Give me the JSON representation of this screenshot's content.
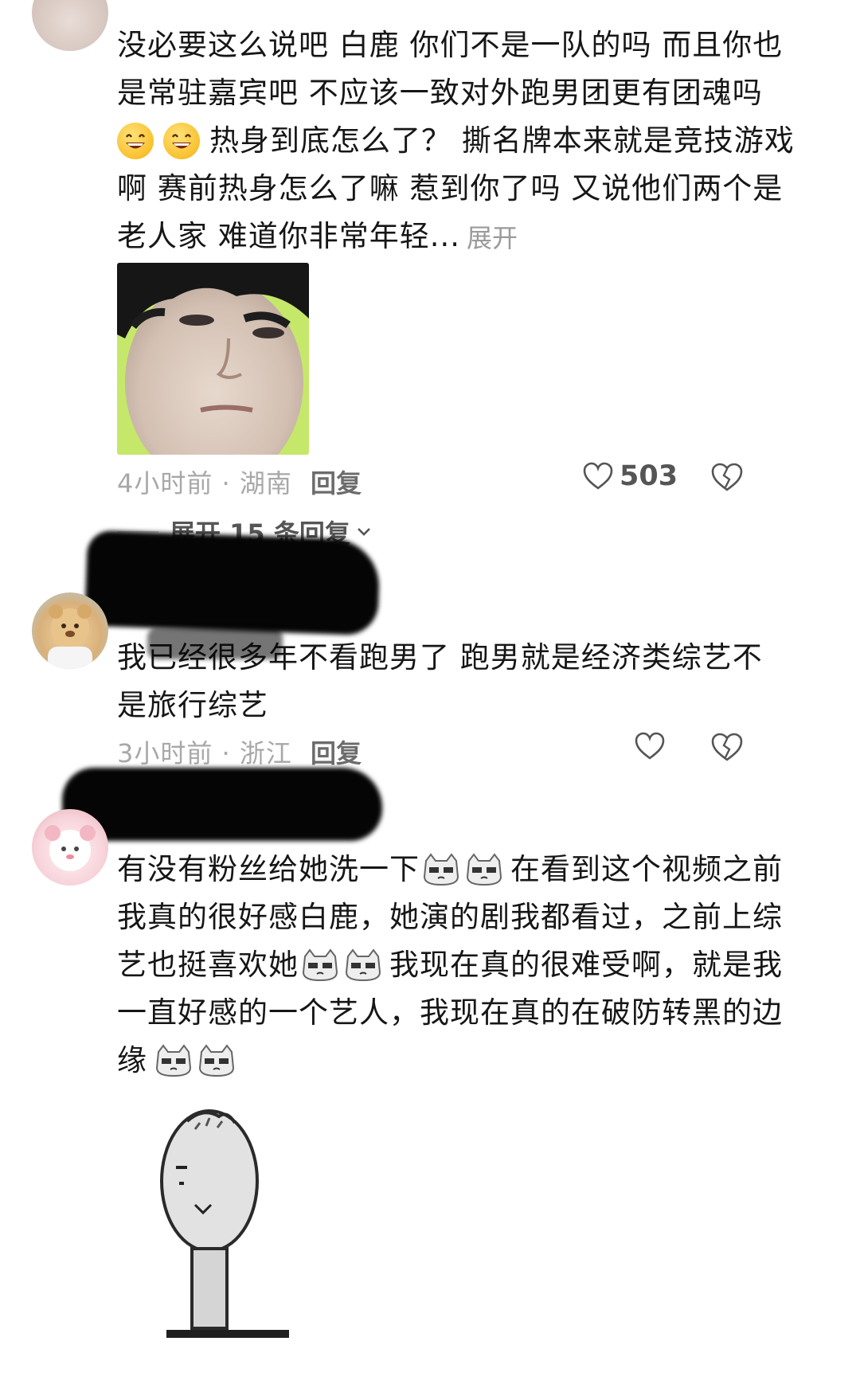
{
  "comments": [
    {
      "text_lines": [
        "没必要这么说吧 白鹿 你们不是一队的吗 而且你也",
        "是常驻嘉宾吧 不应该一致对外跑男团更有团魂吗",
        "热身到底怎么了？ 撕名牌本来就是竞技游戏",
        "啊 赛前热身怎么了嘛 惹到你了吗 又说他们两个是",
        "老人家 难道你非常年轻..."
      ],
      "emoji_inline": [
        "grinning-emoji",
        "grinning-emoji"
      ],
      "expand_label": "展开",
      "meta": "4小时前 · 湖南",
      "reply_label": "回复",
      "likes": "503",
      "sub_replies_label": "展开 15 条回复"
    },
    {
      "text_lines": [
        "我已经很多年不看跑男了 跑男就是经济类综艺不",
        "是旅行综艺"
      ],
      "meta": "3小时前 · 浙江",
      "reply_label": "回复"
    },
    {
      "text_lines": [
        "有没有粉丝给她洗一下",
        "在看到这个视频之前",
        "我真的很好感白鹿，她演的剧我都看过，之前上综",
        "艺也挺喜欢她",
        "我现在真的很难受啊，就是我",
        "一直好感的一个艺人，我现在真的在破防转黑的边",
        "缘"
      ]
    }
  ],
  "colors": {
    "text": "#161616",
    "meta": "#a8a8a8",
    "reply": "#6c6c6c",
    "icon": "#555555"
  }
}
